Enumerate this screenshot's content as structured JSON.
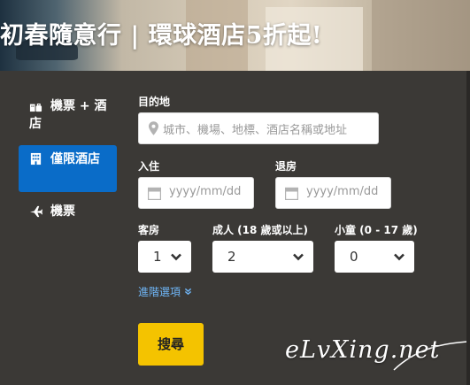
{
  "banner": {
    "title": "初春隨意行 | 環球酒店5折起!"
  },
  "sidebar": {
    "items": [
      {
        "label": "機票 + 酒店",
        "icon": "flight-hotel-icon",
        "active": false
      },
      {
        "label": "僅限酒店",
        "icon": "hotel-building-icon",
        "active": true
      },
      {
        "label": "機票",
        "icon": "airplane-icon",
        "active": false
      }
    ]
  },
  "form": {
    "destination": {
      "label": "目的地",
      "placeholder": "城市、機場、地標、酒店名稱或地址"
    },
    "checkin": {
      "label": "入住",
      "placeholder": "yyyy/mm/dd"
    },
    "checkout": {
      "label": "退房",
      "placeholder": "yyyy/mm/dd"
    },
    "rooms": {
      "label": "客房",
      "value": "1"
    },
    "adults": {
      "label": "成人 (18 歲或以上)",
      "value": "2"
    },
    "children": {
      "label": "小童 (0 - 17 歲)",
      "value": "0"
    },
    "advanced_label": "進階選項",
    "search_label": "搜尋"
  },
  "watermark": "eLvXing.net",
  "colors": {
    "active_tab": "#0a6cc8",
    "search_button": "#f4c300",
    "link": "#6fb6f7",
    "panel": "#3b3936"
  }
}
